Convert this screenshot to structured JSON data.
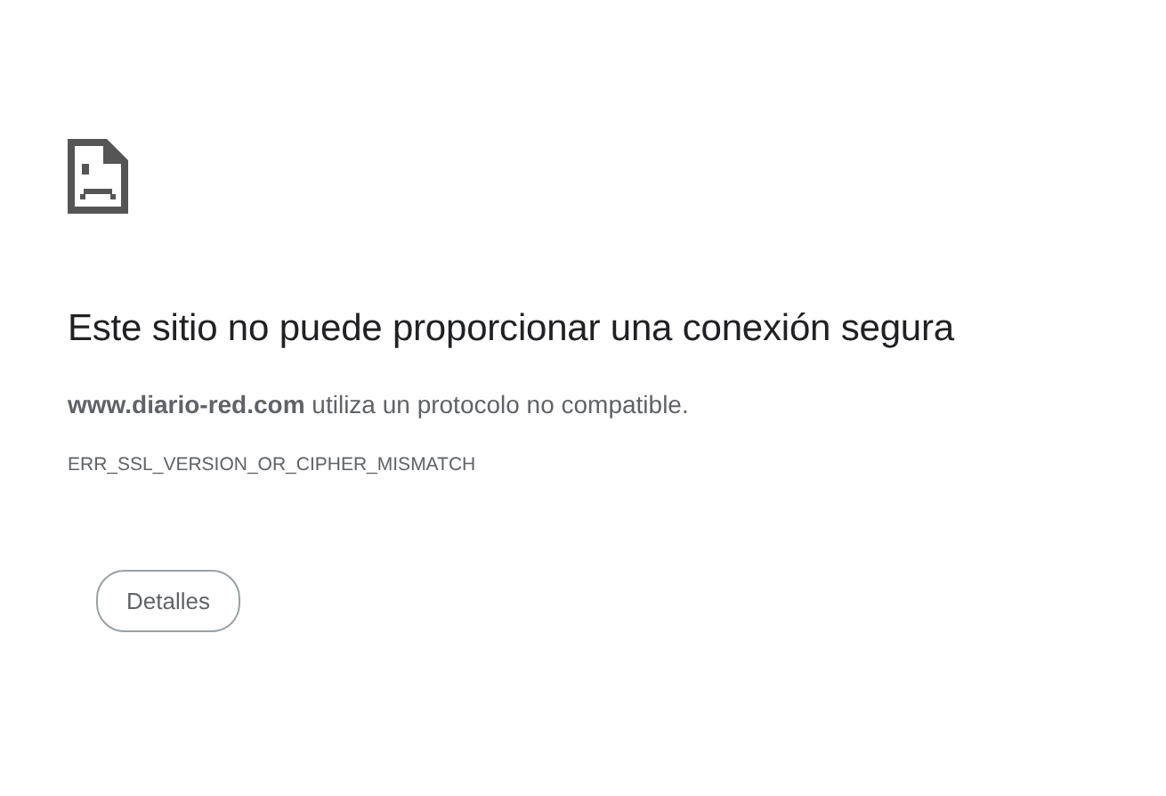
{
  "heading": "Este sitio no puede proporcionar una conexión segura",
  "message": "**www.diario-red.com** utiliza un protocolo no compatible.",
  "error_code": "ERR_SSL_VERSION_OR_CIPHER_MISMATCH",
  "buttons": [
    "Detalles"
  ]
}
